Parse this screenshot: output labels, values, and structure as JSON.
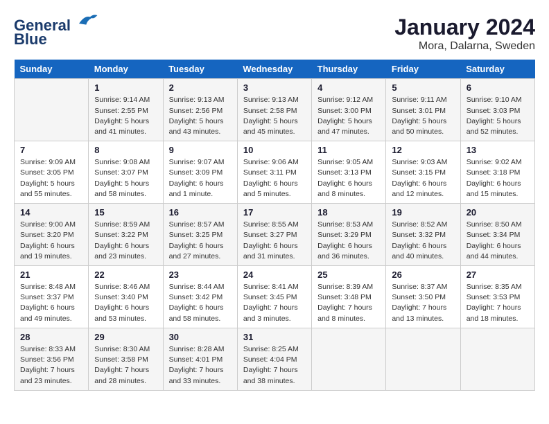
{
  "logo": {
    "line1": "General",
    "line2": "Blue"
  },
  "title": "January 2024",
  "subtitle": "Mora, Dalarna, Sweden",
  "days_of_week": [
    "Sunday",
    "Monday",
    "Tuesday",
    "Wednesday",
    "Thursday",
    "Friday",
    "Saturday"
  ],
  "weeks": [
    [
      {
        "day": "",
        "info": ""
      },
      {
        "day": "1",
        "info": "Sunrise: 9:14 AM\nSunset: 2:55 PM\nDaylight: 5 hours\nand 41 minutes."
      },
      {
        "day": "2",
        "info": "Sunrise: 9:13 AM\nSunset: 2:56 PM\nDaylight: 5 hours\nand 43 minutes."
      },
      {
        "day": "3",
        "info": "Sunrise: 9:13 AM\nSunset: 2:58 PM\nDaylight: 5 hours\nand 45 minutes."
      },
      {
        "day": "4",
        "info": "Sunrise: 9:12 AM\nSunset: 3:00 PM\nDaylight: 5 hours\nand 47 minutes."
      },
      {
        "day": "5",
        "info": "Sunrise: 9:11 AM\nSunset: 3:01 PM\nDaylight: 5 hours\nand 50 minutes."
      },
      {
        "day": "6",
        "info": "Sunrise: 9:10 AM\nSunset: 3:03 PM\nDaylight: 5 hours\nand 52 minutes."
      }
    ],
    [
      {
        "day": "7",
        "info": "Sunrise: 9:09 AM\nSunset: 3:05 PM\nDaylight: 5 hours\nand 55 minutes."
      },
      {
        "day": "8",
        "info": "Sunrise: 9:08 AM\nSunset: 3:07 PM\nDaylight: 5 hours\nand 58 minutes."
      },
      {
        "day": "9",
        "info": "Sunrise: 9:07 AM\nSunset: 3:09 PM\nDaylight: 6 hours\nand 1 minute."
      },
      {
        "day": "10",
        "info": "Sunrise: 9:06 AM\nSunset: 3:11 PM\nDaylight: 6 hours\nand 5 minutes."
      },
      {
        "day": "11",
        "info": "Sunrise: 9:05 AM\nSunset: 3:13 PM\nDaylight: 6 hours\nand 8 minutes."
      },
      {
        "day": "12",
        "info": "Sunrise: 9:03 AM\nSunset: 3:15 PM\nDaylight: 6 hours\nand 12 minutes."
      },
      {
        "day": "13",
        "info": "Sunrise: 9:02 AM\nSunset: 3:18 PM\nDaylight: 6 hours\nand 15 minutes."
      }
    ],
    [
      {
        "day": "14",
        "info": "Sunrise: 9:00 AM\nSunset: 3:20 PM\nDaylight: 6 hours\nand 19 minutes."
      },
      {
        "day": "15",
        "info": "Sunrise: 8:59 AM\nSunset: 3:22 PM\nDaylight: 6 hours\nand 23 minutes."
      },
      {
        "day": "16",
        "info": "Sunrise: 8:57 AM\nSunset: 3:25 PM\nDaylight: 6 hours\nand 27 minutes."
      },
      {
        "day": "17",
        "info": "Sunrise: 8:55 AM\nSunset: 3:27 PM\nDaylight: 6 hours\nand 31 minutes."
      },
      {
        "day": "18",
        "info": "Sunrise: 8:53 AM\nSunset: 3:29 PM\nDaylight: 6 hours\nand 36 minutes."
      },
      {
        "day": "19",
        "info": "Sunrise: 8:52 AM\nSunset: 3:32 PM\nDaylight: 6 hours\nand 40 minutes."
      },
      {
        "day": "20",
        "info": "Sunrise: 8:50 AM\nSunset: 3:34 PM\nDaylight: 6 hours\nand 44 minutes."
      }
    ],
    [
      {
        "day": "21",
        "info": "Sunrise: 8:48 AM\nSunset: 3:37 PM\nDaylight: 6 hours\nand 49 minutes."
      },
      {
        "day": "22",
        "info": "Sunrise: 8:46 AM\nSunset: 3:40 PM\nDaylight: 6 hours\nand 53 minutes."
      },
      {
        "day": "23",
        "info": "Sunrise: 8:44 AM\nSunset: 3:42 PM\nDaylight: 6 hours\nand 58 minutes."
      },
      {
        "day": "24",
        "info": "Sunrise: 8:41 AM\nSunset: 3:45 PM\nDaylight: 7 hours\nand 3 minutes."
      },
      {
        "day": "25",
        "info": "Sunrise: 8:39 AM\nSunset: 3:48 PM\nDaylight: 7 hours\nand 8 minutes."
      },
      {
        "day": "26",
        "info": "Sunrise: 8:37 AM\nSunset: 3:50 PM\nDaylight: 7 hours\nand 13 minutes."
      },
      {
        "day": "27",
        "info": "Sunrise: 8:35 AM\nSunset: 3:53 PM\nDaylight: 7 hours\nand 18 minutes."
      }
    ],
    [
      {
        "day": "28",
        "info": "Sunrise: 8:33 AM\nSunset: 3:56 PM\nDaylight: 7 hours\nand 23 minutes."
      },
      {
        "day": "29",
        "info": "Sunrise: 8:30 AM\nSunset: 3:58 PM\nDaylight: 7 hours\nand 28 minutes."
      },
      {
        "day": "30",
        "info": "Sunrise: 8:28 AM\nSunset: 4:01 PM\nDaylight: 7 hours\nand 33 minutes."
      },
      {
        "day": "31",
        "info": "Sunrise: 8:25 AM\nSunset: 4:04 PM\nDaylight: 7 hours\nand 38 minutes."
      },
      {
        "day": "",
        "info": ""
      },
      {
        "day": "",
        "info": ""
      },
      {
        "day": "",
        "info": ""
      }
    ]
  ]
}
